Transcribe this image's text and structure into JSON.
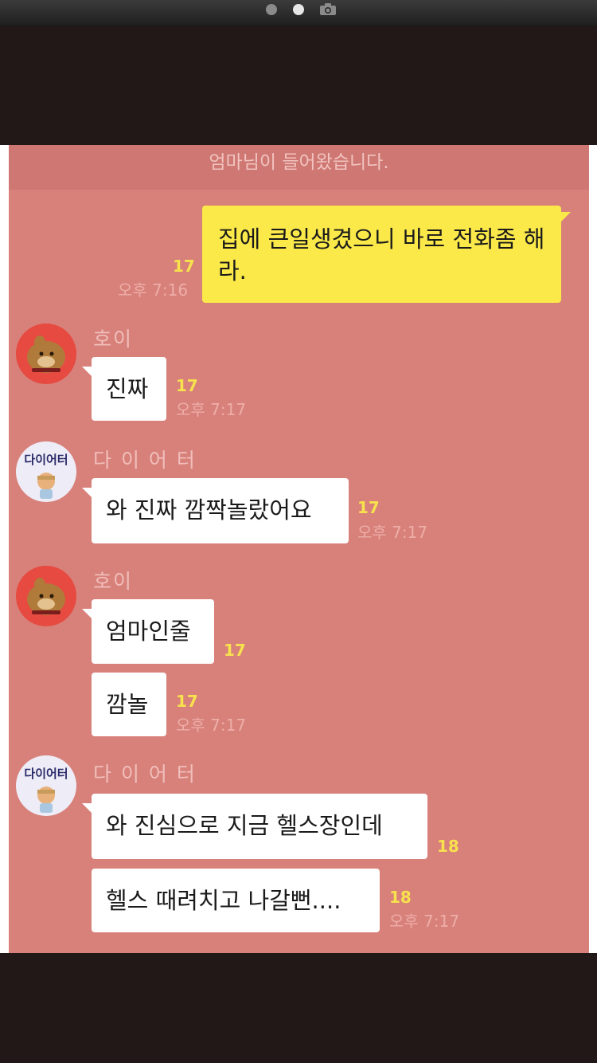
{
  "notice": "엄마님이 들어왔습니다.",
  "messages": [
    {
      "text": "집에 큰일생겼으니 바로 전화좀 해라.",
      "unread": "17",
      "time": "오후 7:16"
    },
    {
      "sender": "호이",
      "text": "진짜",
      "unread": "17",
      "time": "오후 7:17"
    },
    {
      "sender": "다 이 어 터",
      "avatar_text": "다이어터",
      "text": "와 진짜 깜짝놀랐어요",
      "unread": "17",
      "time": "오후 7:17"
    },
    {
      "sender": "호이",
      "text": "엄마인줄",
      "unread": "17"
    },
    {
      "text": "깜놀",
      "unread": "17",
      "time": "오후 7:17"
    },
    {
      "sender": "다 이 어 터",
      "avatar_text": "다이어터",
      "text": "와 진심으로 지금 헬스장인데",
      "unread": "18"
    },
    {
      "text": "헬스 때려치고 나갈뻔....",
      "unread": "18",
      "time": "오후 7:17"
    }
  ],
  "colors": {
    "chat_bg": "#d8807a",
    "my_bubble": "#fbe94a",
    "other_bubble": "#ffffff",
    "unread": "#f7e24d"
  }
}
